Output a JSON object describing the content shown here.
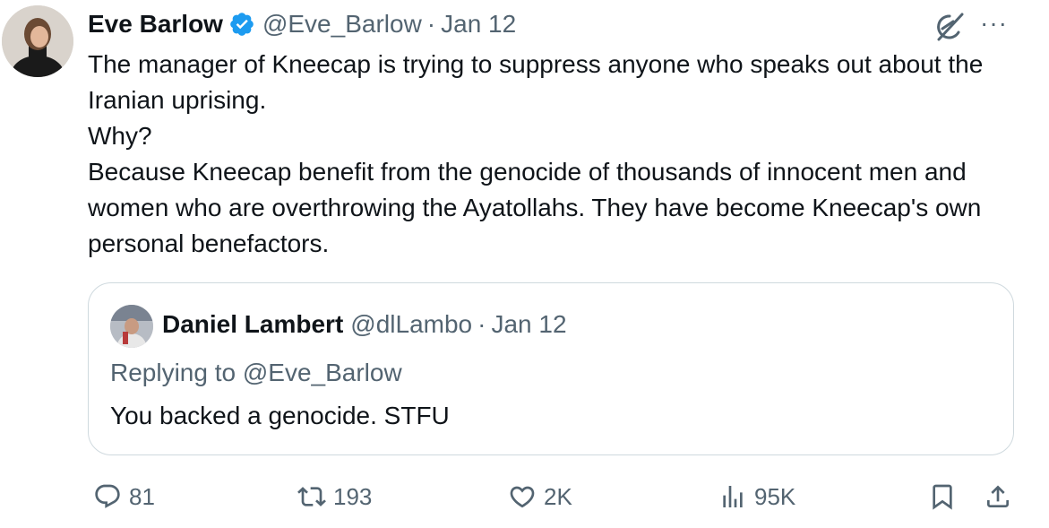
{
  "tweet": {
    "author_name": "Eve Barlow",
    "handle": "@Eve_Barlow",
    "date": "Jan 12",
    "separator": "·",
    "more_label": "···",
    "body_lines": [
      "The manager of Kneecap is trying to suppress anyone who speaks out about the Iranian uprising.",
      "Why?",
      "Because Kneecap benefit from the genocide of thousands of innocent men and women who are overthrowing the Ayatollahs. They have become Kneecap's own personal benefactors."
    ]
  },
  "quote": {
    "author_name": "Daniel Lambert",
    "handle": "@dlLambo",
    "date": "Jan 12",
    "separator": "·",
    "replying_to": "Replying to @Eve_Barlow",
    "text": "You backed a genocide. STFU"
  },
  "actions": {
    "replies": "81",
    "reposts": "193",
    "likes": "2K",
    "views": "95K"
  },
  "icons": {
    "verified": "verified-badge-icon",
    "grok": "grok-icon",
    "reply": "reply-icon",
    "repost": "repost-icon",
    "like": "heart-icon",
    "views": "views-icon",
    "bookmark": "bookmark-icon",
    "share": "share-icon"
  },
  "colors": {
    "primary_text": "#0f1419",
    "secondary_text": "#536471",
    "verified_blue": "#1d9bf0",
    "border": "#cfd9de"
  }
}
